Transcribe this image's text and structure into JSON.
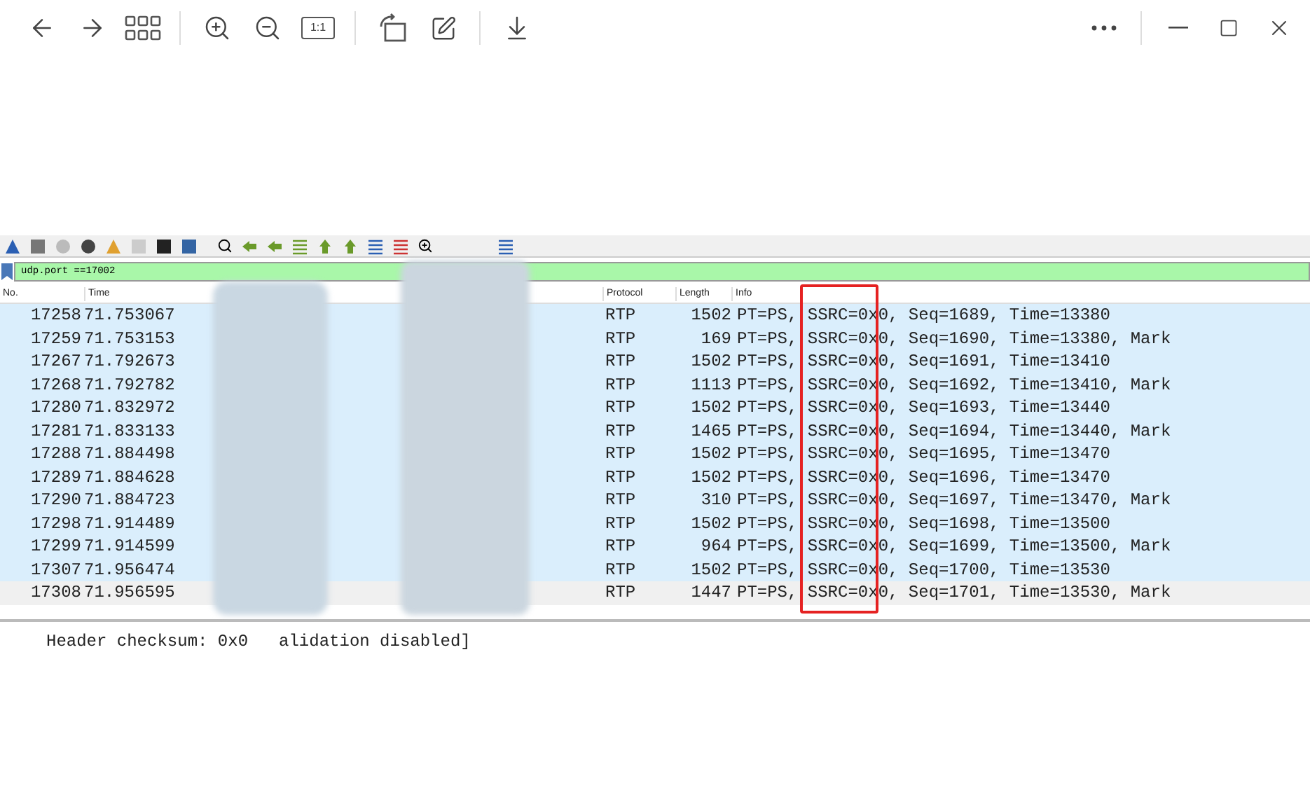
{
  "viewer_toolbar": {
    "actual_size_label": "1:1"
  },
  "capture": {
    "filter": "udp.port ==17002",
    "columns": [
      {
        "label": "No."
      },
      {
        "label": "Time"
      },
      {
        "label": "Protocol"
      },
      {
        "label": "Length"
      },
      {
        "label": "Info"
      }
    ],
    "rows": [
      {
        "no": "17258",
        "time": "71.753067",
        "protocol": "RTP",
        "length": "1502",
        "info": "PT=PS, SSRC=0x0, Seq=1689, Time=13380",
        "selected": true
      },
      {
        "no": "17259",
        "time": "71.753153",
        "protocol": "RTP",
        "length": "169",
        "info": "PT=PS, SSRC=0x0, Seq=1690, Time=13380, Mark",
        "selected": true
      },
      {
        "no": "17267",
        "time": "71.792673",
        "protocol": "RTP",
        "length": "1502",
        "info": "PT=PS, SSRC=0x0, Seq=1691, Time=13410",
        "selected": true
      },
      {
        "no": "17268",
        "time": "71.792782",
        "protocol": "RTP",
        "length": "1113",
        "info": "PT=PS, SSRC=0x0, Seq=1692, Time=13410, Mark",
        "selected": true
      },
      {
        "no": "17280",
        "time": "71.832972",
        "protocol": "RTP",
        "length": "1502",
        "info": "PT=PS, SSRC=0x0, Seq=1693, Time=13440",
        "selected": true
      },
      {
        "no": "17281",
        "time": "71.833133",
        "protocol": "RTP",
        "length": "1465",
        "info": "PT=PS, SSRC=0x0, Seq=1694, Time=13440, Mark",
        "selected": true
      },
      {
        "no": "17288",
        "time": "71.884498",
        "protocol": "RTP",
        "length": "1502",
        "info": "PT=PS, SSRC=0x0, Seq=1695, Time=13470",
        "selected": true
      },
      {
        "no": "17289",
        "time": "71.884628",
        "protocol": "RTP",
        "length": "1502",
        "info": "PT=PS, SSRC=0x0, Seq=1696, Time=13470",
        "selected": true
      },
      {
        "no": "17290",
        "time": "71.884723",
        "protocol": "RTP",
        "length": "310",
        "info": "PT=PS, SSRC=0x0, Seq=1697, Time=13470, Mark",
        "selected": true
      },
      {
        "no": "17298",
        "time": "71.914489",
        "protocol": "RTP",
        "length": "1502",
        "info": "PT=PS, SSRC=0x0, Seq=1698, Time=13500",
        "selected": true
      },
      {
        "no": "17299",
        "time": "71.914599",
        "protocol": "RTP",
        "length": "964",
        "info": "PT=PS, SSRC=0x0, Seq=1699, Time=13500, Mark",
        "selected": true
      },
      {
        "no": "17307",
        "time": "71.956474",
        "protocol": "RTP",
        "length": "1502",
        "info": "PT=PS, SSRC=0x0, Seq=1700, Time=13530",
        "selected": true
      },
      {
        "no": "17308",
        "time": "71.956595",
        "protocol": "RTP",
        "length": "1447",
        "info": "PT=PS, SSRC=0x0, Seq=1701, Time=13530, Mark",
        "selected": false
      }
    ],
    "detail_line_start": "Header checksum: 0x0",
    "detail_line_end": "alidation disabled]"
  }
}
